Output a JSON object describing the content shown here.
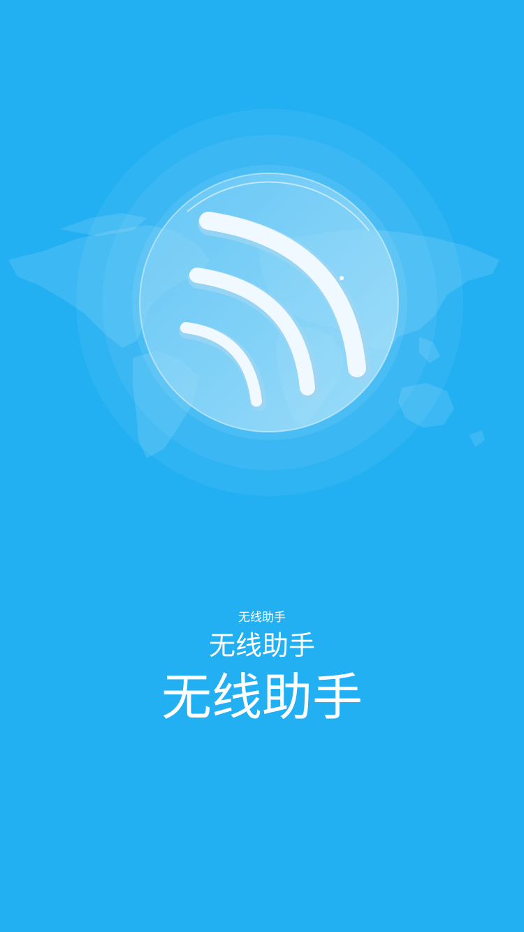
{
  "app": {
    "background_color": "#22b0f3",
    "logo_icon": "wifi-signal-icon",
    "background_art": "world-map"
  },
  "splash": {
    "title_small": "无线助手",
    "title_medium": "无线助手",
    "title_large": "无线助手"
  }
}
